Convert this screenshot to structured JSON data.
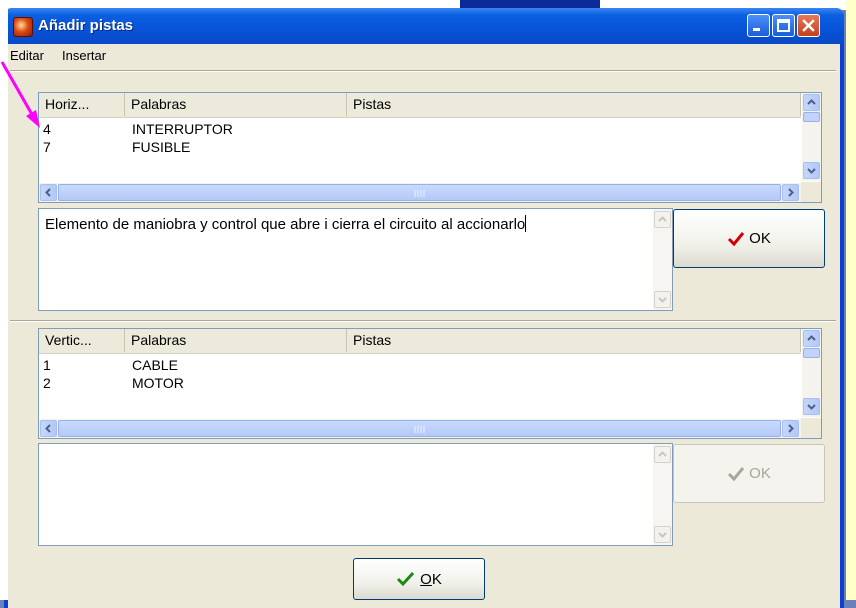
{
  "window": {
    "title": "Añadir pistas",
    "accent": "#0a5fe0",
    "close_color": "#c3401c"
  },
  "menu": {
    "items": [
      "Editar",
      "Insertar"
    ]
  },
  "horizontal": {
    "columns": [
      "Horiz...",
      "Palabras",
      "Pistas"
    ],
    "rows": [
      {
        "num": "4",
        "word": "INTERRUPTOR",
        "clue": ""
      },
      {
        "num": "7",
        "word": "FUSIBLE",
        "clue": ""
      }
    ],
    "clue_text": "Elemento de maniobra y control que abre i cierra el circuito al accionarlo",
    "ok_label": "OK"
  },
  "vertical": {
    "columns": [
      "Vertic...",
      "Palabras",
      "Pistas"
    ],
    "rows": [
      {
        "num": "1",
        "word": "CABLE",
        "clue": ""
      },
      {
        "num": "2",
        "word": "MOTOR",
        "clue": ""
      }
    ],
    "clue_text": "",
    "ok_label": "OK"
  },
  "footer": {
    "ok_label_underlined": "O",
    "ok_label_rest": "K"
  },
  "icons": {
    "check": "check-icon",
    "arrow": "pointer-arrow"
  },
  "colors": {
    "check": "#d40000",
    "check_main": "#1a8a10",
    "annotation_arrow": "#ff00ff"
  }
}
